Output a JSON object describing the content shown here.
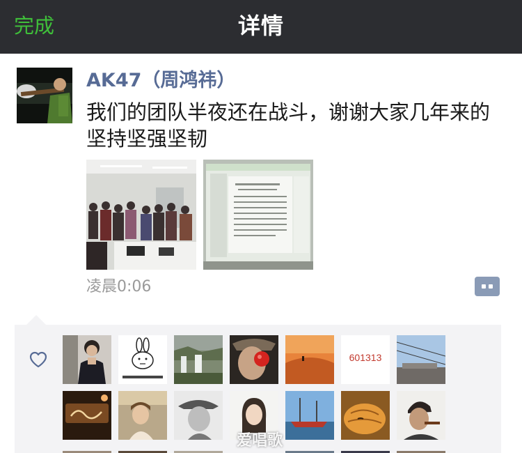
{
  "navbar": {
    "done_label": "完成",
    "title": "详情"
  },
  "post": {
    "author": "AK47（周鸿祎）",
    "text": "我们的团队半夜还在战斗，谢谢大家几年来的坚持坚强坚韧",
    "timestamp": "凌晨0:06",
    "photos": [
      {
        "name": "team-group-photo"
      },
      {
        "name": "screen-document-photo"
      }
    ]
  },
  "likes": {
    "icon": "heart-outline-icon",
    "avatars": [
      {
        "name": "woman-dark-hair"
      },
      {
        "name": "cartoon-rabbit-meme"
      },
      {
        "name": "waterfall-landscape"
      },
      {
        "name": "man-red-nose"
      },
      {
        "name": "desert-sunset"
      },
      {
        "name": "number-text-avatar",
        "text": "601313"
      },
      {
        "name": "sky-building"
      },
      {
        "name": "patricia-sign"
      },
      {
        "name": "woman-smiling"
      },
      {
        "name": "man-cowboy-hat"
      },
      {
        "name": "woman-sketch"
      },
      {
        "name": "harbor-boats"
      },
      {
        "name": "sleeping-cat"
      },
      {
        "name": "man-with-cigar"
      }
    ]
  },
  "watermark": "爱唱歌",
  "colors": {
    "nav_bg": "#2c2d31",
    "done_green": "#3fbf3a",
    "author_blue": "#576b95",
    "timestamp_gray": "#9a9a9a",
    "likes_bg": "#f3f3f5",
    "comment_button": "#8a9bb6"
  }
}
